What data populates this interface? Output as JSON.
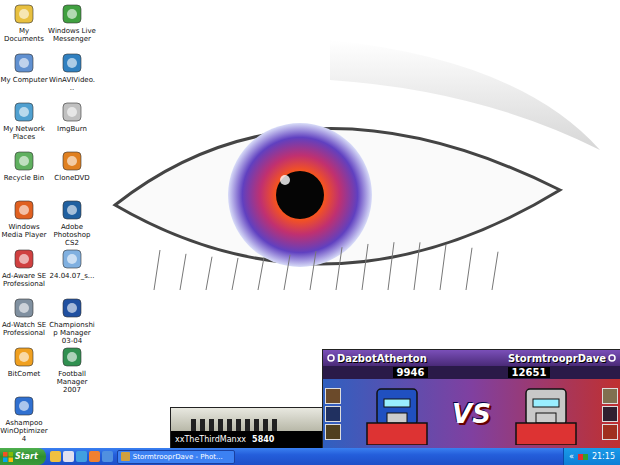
{
  "desktop": {
    "icons": [
      {
        "label": "My Documents"
      },
      {
        "label": "My Computer"
      },
      {
        "label": "My Network Places"
      },
      {
        "label": "Recycle Bin"
      },
      {
        "label": "Windows Media Player"
      },
      {
        "label": "Ad-Aware SE Professional"
      },
      {
        "label": "Ad-Watch SE Professional"
      },
      {
        "label": "BitComet"
      },
      {
        "label": "Ashampoo WinOptimizer 4"
      },
      {
        "label": "Windows Live Messenger"
      },
      {
        "label": "WinAVIVideo..."
      },
      {
        "label": "ImgBurn"
      },
      {
        "label": "CloneDVD"
      },
      {
        "label": "Adobe Photoshop CS2"
      },
      {
        "label": "24.04.07_s..."
      },
      {
        "label": "Championship Manager 03-04"
      },
      {
        "label": "Football Manager 2007"
      }
    ]
  },
  "gamercards": {
    "versus": {
      "players": [
        {
          "tag": "DazbotAtherton",
          "score": "9946"
        },
        {
          "tag": "StormtrooprDave",
          "score": "12651"
        }
      ],
      "vs": "VS"
    },
    "single": {
      "tag": "xxTheThirdManxx",
      "score": "5840"
    }
  },
  "taskbar": {
    "start": "Start",
    "tasks": [
      {
        "label": "StormtrooprDave - Phot...",
        "selected": false
      }
    ],
    "tray": {
      "expand": "«",
      "clock": "21:15"
    }
  }
}
